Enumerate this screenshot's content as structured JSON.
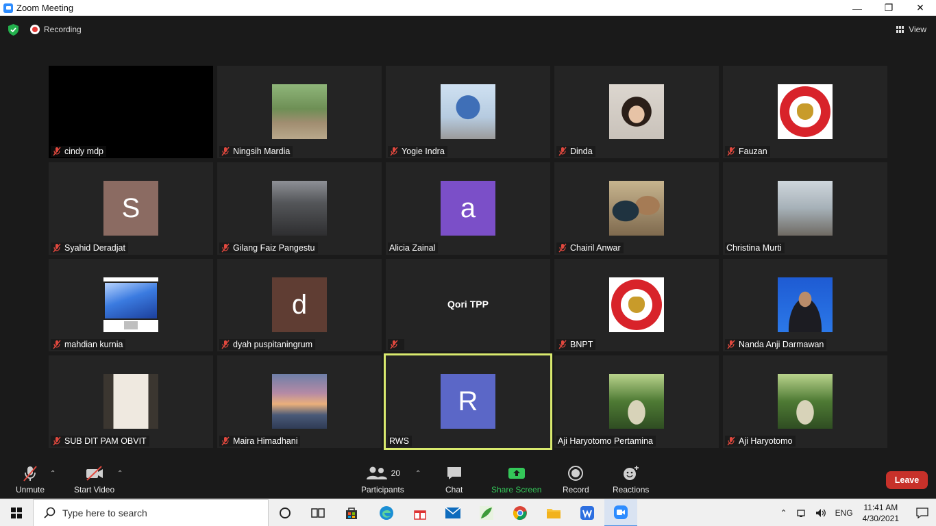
{
  "window": {
    "title": "Zoom Meeting",
    "minimize_glyph": "—",
    "maximize_glyph": "❐",
    "close_glyph": "✕"
  },
  "header": {
    "recording_label": "Recording",
    "view_label": "View"
  },
  "participants": [
    {
      "name": "cindy mdp",
      "muted": true,
      "media": "black"
    },
    {
      "name": "Ningsih Mardia",
      "muted": true,
      "media": "forest-photo"
    },
    {
      "name": "Yogie Indra",
      "muted": true,
      "media": "globe-photo"
    },
    {
      "name": "Dinda",
      "muted": true,
      "media": "woman-photo"
    },
    {
      "name": "Fauzan",
      "muted": true,
      "media": "bnpt-logo"
    },
    {
      "name": "Syahid Deradjat",
      "muted": true,
      "media": "letter",
      "letter": "S",
      "color": "#8b6b62"
    },
    {
      "name": "Gilang Faiz Pangestu",
      "muted": true,
      "media": "cockpit-photo"
    },
    {
      "name": "Alicia Zainal",
      "muted": false,
      "media": "letter",
      "letter": "a",
      "color": "#7b4fc8"
    },
    {
      "name": "Chairil Anwar",
      "muted": true,
      "media": "couple-photo"
    },
    {
      "name": "Christina Murti",
      "muted": false,
      "media": "city-photo"
    },
    {
      "name": "mahdian kurnia",
      "muted": true,
      "media": "imac-photo"
    },
    {
      "name": "dyah puspitaningrum",
      "muted": true,
      "media": "letter",
      "letter": "d",
      "color": "#5f3d33"
    },
    {
      "name": "",
      "display_name": "Qori TPP",
      "muted": true,
      "media": "name-only"
    },
    {
      "name": "BNPT",
      "muted": true,
      "media": "bnpt-logo"
    },
    {
      "name": "Nanda Anji Darmawan",
      "muted": true,
      "media": "man-photo"
    },
    {
      "name": "SUB DIT PAM OBVIT",
      "muted": true,
      "media": "mirror-photo"
    },
    {
      "name": "Maira Himadhani",
      "muted": true,
      "media": "sunset-photo"
    },
    {
      "name": "RWS",
      "muted": false,
      "media": "letter",
      "letter": "R",
      "color": "#5b67c7",
      "active_speaker": true
    },
    {
      "name": "Aji Haryotomo Pertamina",
      "muted": false,
      "media": "road-photo"
    },
    {
      "name": "Aji Haryotomo",
      "muted": true,
      "media": "road-photo"
    }
  ],
  "toolbar": {
    "unmute_label": "Unmute",
    "start_video_label": "Start Video",
    "participants_label": "Participants",
    "participants_count": "20",
    "chat_label": "Chat",
    "share_screen_label": "Share Screen",
    "record_label": "Record",
    "reactions_label": "Reactions",
    "leave_label": "Leave",
    "caret_glyph": "⌃"
  },
  "taskbar": {
    "search_placeholder": "Type here to search",
    "language": "ENG",
    "time": "11:41 AM",
    "date": "4/30/2021",
    "apps": [
      "cortana-icon",
      "task-view-icon",
      "store-icon",
      "edge-icon",
      "gift-icon",
      "mail-icon",
      "leaf-app-icon",
      "chrome-icon",
      "file-explorer-icon",
      "wps-icon",
      "zoom-icon"
    ]
  },
  "colors": {
    "active_speaker_border": "#d9ea6e",
    "leave_button": "#c7312a",
    "share_green": "#34c759",
    "mute_red": "#e0483e"
  }
}
